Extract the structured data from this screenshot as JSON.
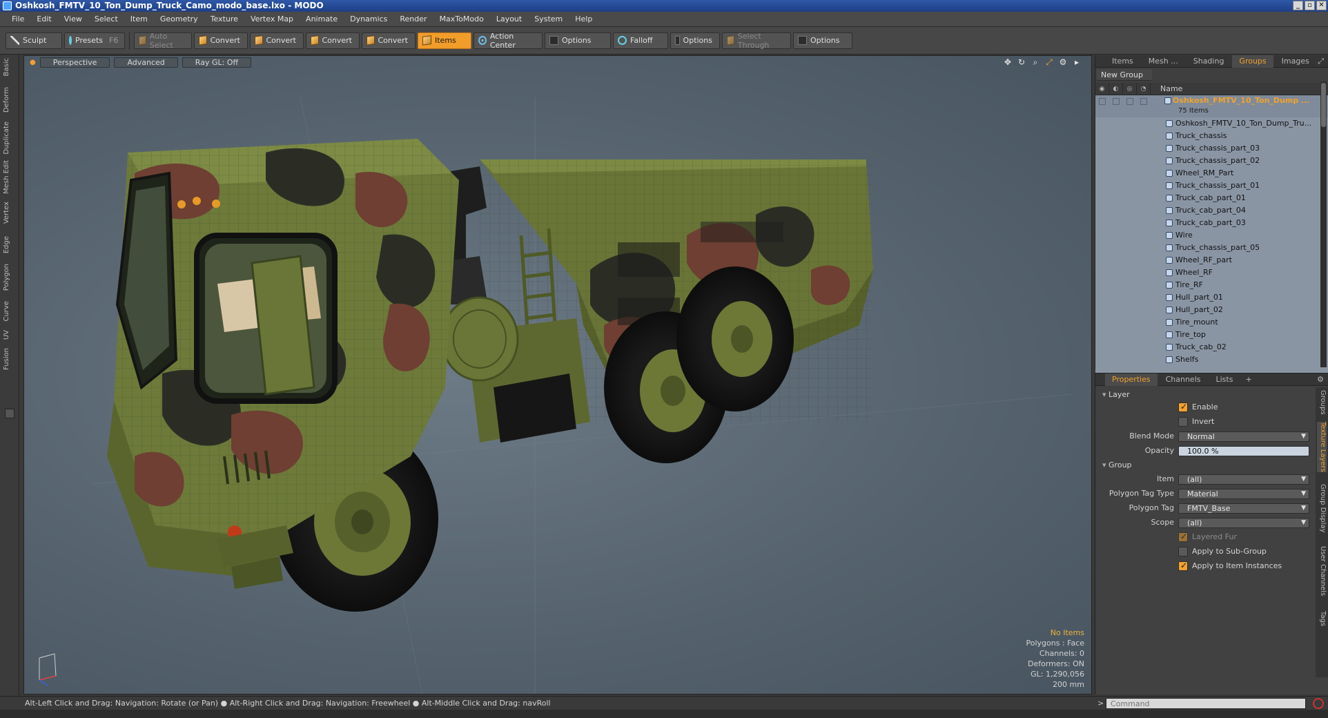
{
  "window": {
    "title": "Oshkosh_FMTV_10_Ton_Dump_Truck_Camo_modo_base.lxo - MODO"
  },
  "menu": [
    "File",
    "Edit",
    "View",
    "Select",
    "Item",
    "Geometry",
    "Texture",
    "Vertex Map",
    "Animate",
    "Dynamics",
    "Render",
    "MaxToModo",
    "Layout",
    "System",
    "Help"
  ],
  "toolbar": {
    "sculpt": "Sculpt",
    "presets": "Presets",
    "presets_key": "F6",
    "auto_select": "Auto Select",
    "convert": "Convert",
    "items": "Items",
    "action_center": "Action Center",
    "options": "Options",
    "falloff": "Falloff",
    "select_through": "Select Through"
  },
  "left_tabs": [
    "Basic",
    "Deform",
    "Duplicate",
    "Mesh Edit",
    "Vertex",
    "Edge",
    "Polygon",
    "Curve",
    "UV",
    "Fusion"
  ],
  "viewport": {
    "view": "Perspective",
    "shading": "Advanced",
    "raygl": "Ray GL: Off",
    "stats": {
      "selection": "No Items",
      "polygons": "Polygons : Face",
      "channels": "Channels: 0",
      "deformers": "Deformers: ON",
      "gl": "GL: 1,290,056",
      "scale": "200 mm"
    }
  },
  "top_panel": {
    "tabs": [
      "Items",
      "Mesh ...",
      "Shading",
      "Groups",
      "Images"
    ],
    "active_tab": "Groups",
    "new_group": "New Group",
    "name_header": "Name",
    "group_name": "Oshkosh_FMTV_10_Ton_Dump ...",
    "group_count": "75 Items",
    "items": [
      "Oshkosh_FMTV_10_Ton_Dump_Tru...",
      "Truck_chassis",
      "Truck_chassis_part_03",
      "Truck_chassis_part_02",
      "Wheel_RM_Part",
      "Truck_chassis_part_01",
      "Truck_cab_part_01",
      "Truck_cab_part_04",
      "Truck_cab_part_03",
      "Wire",
      "Truck_chassis_part_05",
      "Wheel_RF_part",
      "Wheel_RF",
      "Tire_RF",
      "Hull_part_01",
      "Hull_part_02",
      "Tire_mount",
      "Tire_top",
      "Truck_cab_02",
      "Shelfs"
    ]
  },
  "properties": {
    "tabs": [
      "Properties",
      "Channels",
      "Lists"
    ],
    "side_tabs": [
      "Groups",
      "Texture Layers",
      "Group Display",
      "User Channels",
      "Tags"
    ],
    "layer_section": "Layer",
    "enable": "Enable",
    "invert": "Invert",
    "blend_mode_label": "Blend Mode",
    "blend_mode": "Normal",
    "opacity_label": "Opacity",
    "opacity": "100.0 %",
    "group_section": "Group",
    "item_label": "Item",
    "item": "(all)",
    "poly_tag_type_label": "Polygon Tag Type",
    "poly_tag_type": "Material",
    "poly_tag_label": "Polygon Tag",
    "poly_tag": "FMTV_Base",
    "scope_label": "Scope",
    "scope": "(all)",
    "layered_fur": "Layered Fur",
    "apply_sub": "Apply to Sub-Group",
    "apply_inst": "Apply to Item Instances"
  },
  "status": "Alt-Left Click and Drag: Navigation: Rotate (or Pan) ● Alt-Right Click and Drag: Navigation: Freewheel ● Alt-Middle Click and Drag: navRoll",
  "command": {
    "placeholder": "Command"
  },
  "colors": {
    "accent": "#f2a12f",
    "camo_green": "#6f7b3c",
    "camo_brown": "#6e3f32",
    "camo_black": "#2a2a28"
  }
}
